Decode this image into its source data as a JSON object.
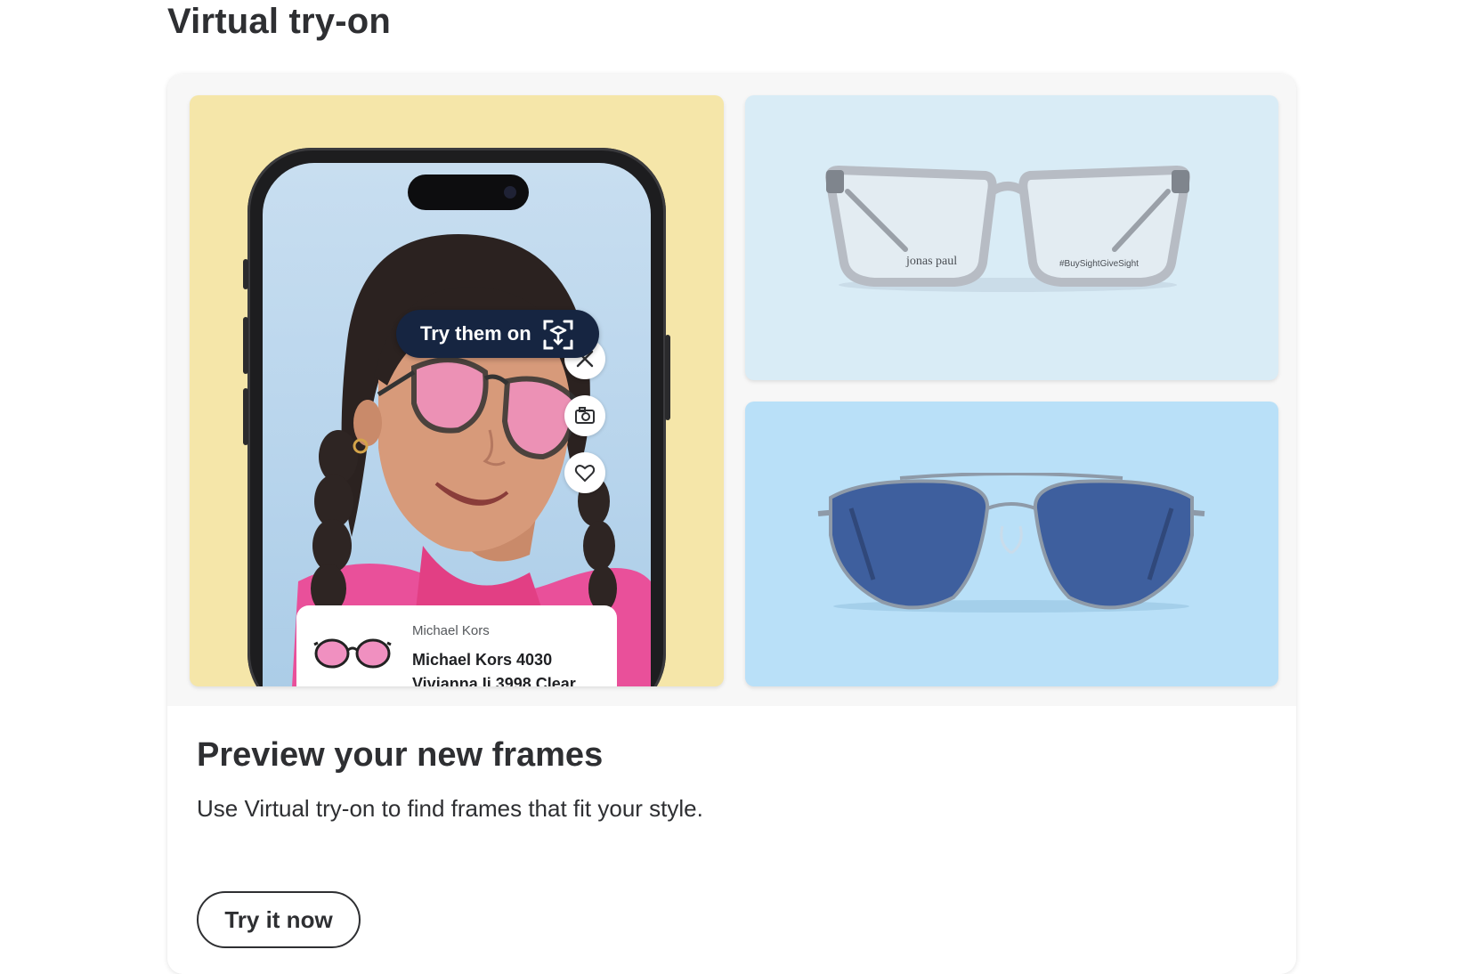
{
  "section": {
    "title": "Virtual try-on"
  },
  "phone_mock": {
    "pill_label": "Try them on",
    "product_brand": "Michael Kors",
    "product_name": "Michael Kors 4030 Vivianna Ii 3998 Clear..."
  },
  "frames_top": {
    "temple_left_text": "jonas paul",
    "temple_right_text": "#BuySightGiveSight"
  },
  "promo": {
    "headline": "Preview your new frames",
    "description": "Use Virtual try-on to find frames that fit your style.",
    "cta_label": "Try it now"
  },
  "colors": {
    "left_tile_bg": "#f5e6a9",
    "top_tile_bg": "#d9ecf6",
    "bottom_tile_bg": "#b9e0f8",
    "pill_bg": "#162541",
    "lens_pink": "#f090c0",
    "lens_blue": "#3a5a9c"
  },
  "icons": [
    "close-icon",
    "camera-icon",
    "heart-icon",
    "ar-cube-icon"
  ]
}
